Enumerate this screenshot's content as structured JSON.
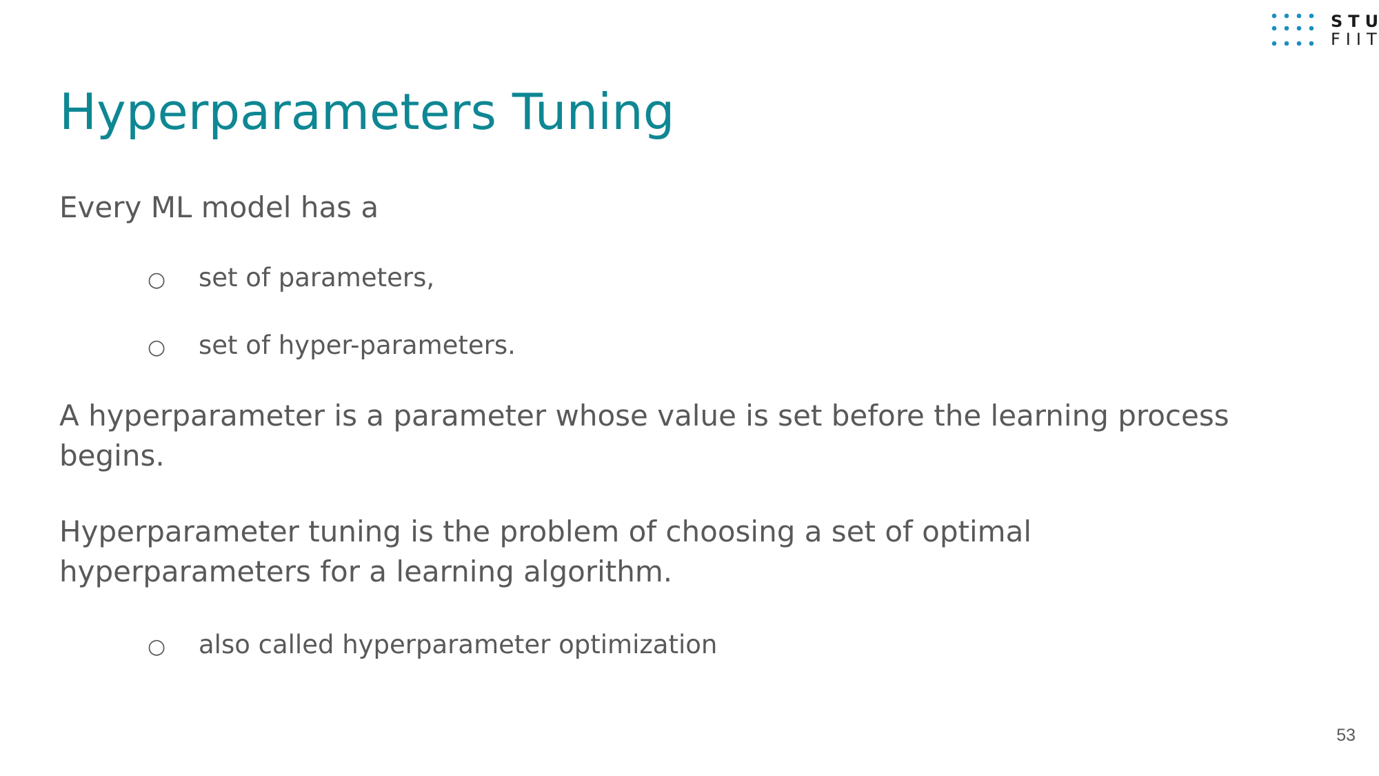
{
  "logo": {
    "line1": "STU",
    "line2": "FIIT",
    "dot_color": "#1b8fc0"
  },
  "slide": {
    "title": "Hyperparameters Tuning",
    "intro": "Every ML model has a",
    "intro_bullets": [
      "set of parameters,",
      "set of hyper-parameters."
    ],
    "definition": "A hyperparameter is a parameter whose value is set before the learning process begins.",
    "tuning": "Hyperparameter tuning is the problem of choosing a set of optimal hyperparameters for a learning algorithm.",
    "tuning_bullets": [
      "also called hyperparameter optimization"
    ],
    "bullet_marker": "○",
    "page_number": "53"
  },
  "colors": {
    "title": "#0e8793",
    "body": "#595959"
  }
}
